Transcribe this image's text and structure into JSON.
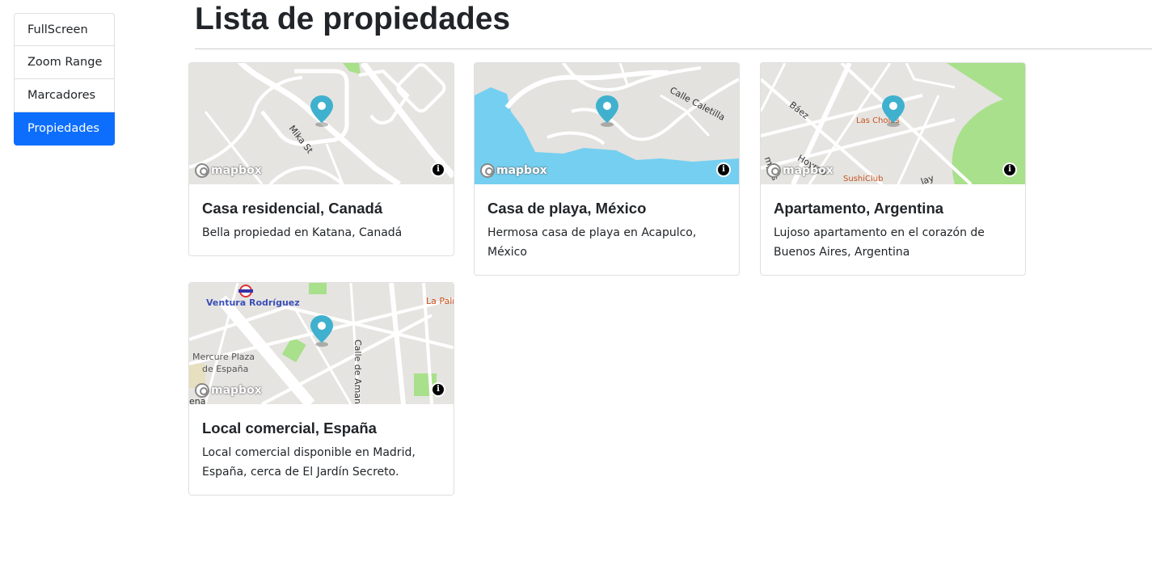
{
  "sidebar": {
    "items": [
      {
        "label": "FullScreen",
        "active": false
      },
      {
        "label": "Zoom Range",
        "active": false
      },
      {
        "label": "Marcadores",
        "active": false
      },
      {
        "label": "Propiedades",
        "active": true
      }
    ]
  },
  "page": {
    "title": "Lista de propiedades"
  },
  "properties": [
    {
      "title": "Casa residencial, Canadá",
      "description": "Bella propiedad en Katana, Canadá",
      "map_labels": [
        "Mika St"
      ]
    },
    {
      "title": "Casa de playa, México",
      "description": "Hermosa casa de playa en Acapulco, México",
      "map_labels": [
        "Calle Caletilla"
      ]
    },
    {
      "title": "Apartamento, Argentina",
      "description": "Lujoso apartamento en el corazón de Buenos Aires, Argentina",
      "map_labels": [
        "Báez",
        "Las Cholas",
        "SushiClub",
        "Hoyrgo",
        "mpos",
        "lay"
      ]
    },
    {
      "title": "Local comercial, España",
      "description": "Local comercial disponible en Madrid, España, cerca de El Jardín Secreto.",
      "map_labels": [
        "Ventura Rodríguez",
        "Mercure Plaza",
        "de España",
        "Calle de Amaniel",
        "La Palr",
        "ena"
      ]
    }
  ],
  "map_attribution": "mapbox",
  "info_icon": "i",
  "colors": {
    "accent": "#0d6efd",
    "marker": "#3fb1ce",
    "water": "#75cff0",
    "park": "#a8e08b",
    "land": "#e5e4e1"
  }
}
